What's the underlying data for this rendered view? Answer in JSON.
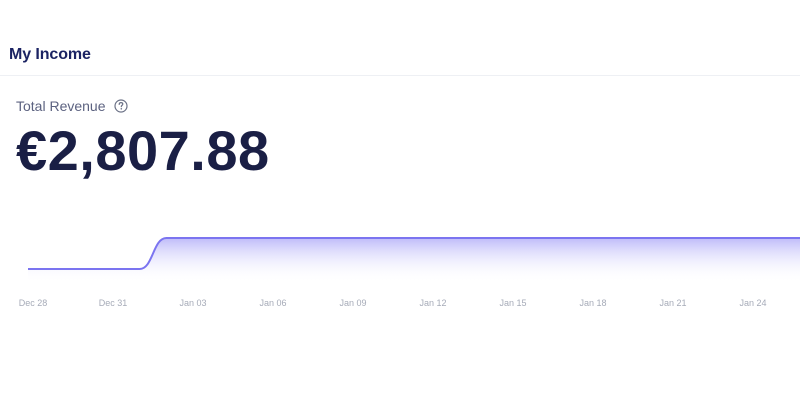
{
  "header": {
    "title": "My Income"
  },
  "metric": {
    "label": "Total Revenue",
    "help_icon": "question-circle-icon",
    "value": "€2,807.88"
  },
  "colors": {
    "title": "#1b2363",
    "value": "#1a1f45",
    "line": "#7b74f0",
    "fill_top": "#8a84f5",
    "fill_bottom": "#ffffff"
  },
  "chart_data": {
    "type": "area",
    "x_ticks": [
      "Dec 28",
      "Dec 31",
      "Jan 03",
      "Jan 06",
      "Jan 09",
      "Jan 12",
      "Jan 15",
      "Jan 18",
      "Jan 21",
      "Jan 24"
    ],
    "series": [
      {
        "points": [
          {
            "x": "Dec 28",
            "y": 0
          },
          {
            "x": "Jan 01",
            "y": 0
          },
          {
            "x": "Jan 02",
            "y": 2807.88
          },
          {
            "x": "Jan 26",
            "y": 2807.88
          }
        ]
      }
    ],
    "grid": false,
    "legend": "none"
  }
}
